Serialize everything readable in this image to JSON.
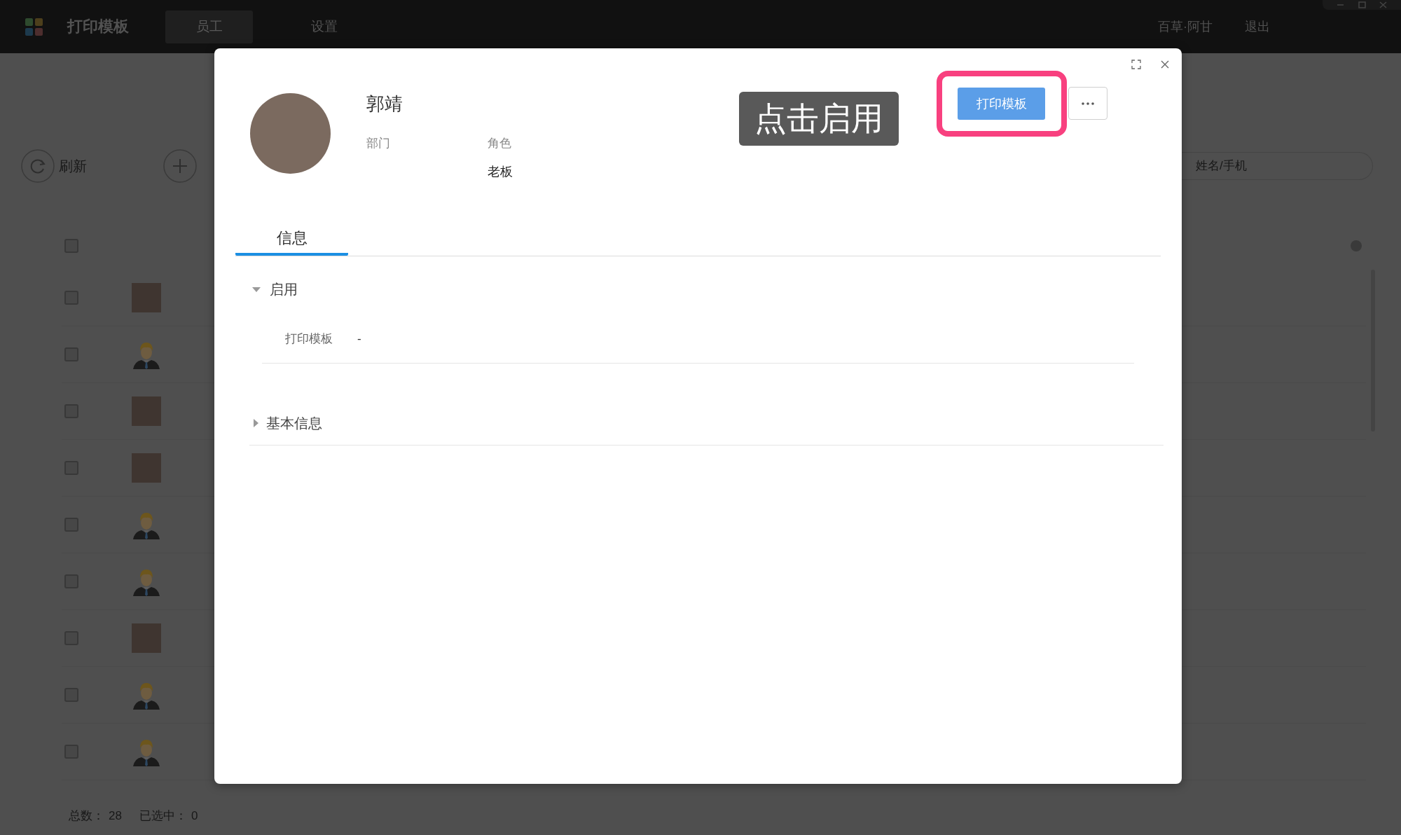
{
  "app_bar": {
    "title": "打印模板",
    "tabs": [
      {
        "label": "员工",
        "selected": true
      },
      {
        "label": "设置",
        "selected": false
      }
    ],
    "user": "百草·阿甘",
    "logout": "退出"
  },
  "toolbar": {
    "buttons": [
      {
        "kind": "refresh",
        "label": "刷新"
      },
      {
        "kind": "add"
      }
    ],
    "search": {
      "placeholder": "姓名/手机"
    }
  },
  "table": {
    "select_all": {
      "checked": false
    },
    "rows": [
      {
        "checked": false,
        "kind": "photo"
      },
      {
        "checked": false,
        "kind": "default"
      },
      {
        "checked": false,
        "kind": "photo"
      },
      {
        "checked": false,
        "kind": "photo"
      },
      {
        "checked": false,
        "kind": "default"
      },
      {
        "checked": false,
        "kind": "default"
      },
      {
        "checked": false,
        "kind": "photo"
      },
      {
        "checked": false,
        "kind": "default"
      },
      {
        "checked": false,
        "kind": "default"
      }
    ]
  },
  "footer": [
    {
      "label": "总数：",
      "value": "28"
    },
    {
      "label": "已选中：",
      "value": "0"
    }
  ],
  "dialog": {
    "name": "郭靖",
    "fields": [
      {
        "label": "部门"
      },
      {
        "label": "角色",
        "value": "老板"
      }
    ],
    "tooltip": "点击启用",
    "print_button": {
      "label": "打印模板",
      "highlighted": true
    },
    "tabs": [
      {
        "label": "信息",
        "selected": true
      }
    ],
    "sections": [
      {
        "title": "启用",
        "expanded": true,
        "rows": [
          {
            "label": "打印模板",
            "value": "-"
          }
        ]
      },
      {
        "title": "基本信息",
        "expanded": false
      }
    ]
  }
}
